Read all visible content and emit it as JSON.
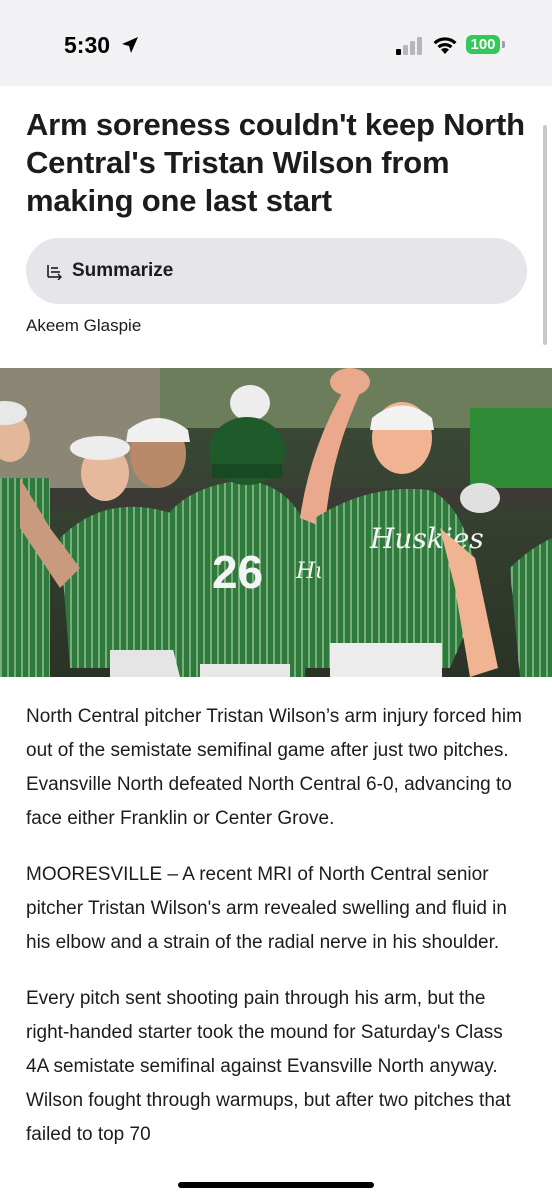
{
  "status_bar": {
    "time": "5:30",
    "battery": "100",
    "icons": [
      "location-arrow-icon",
      "cellular-signal-icon",
      "wifi-icon",
      "battery-icon"
    ]
  },
  "article": {
    "headline": "Arm soreness couldn't keep North Central's Tristan Wilson from making one last start",
    "summarize_label": "Summarize",
    "author": "Akeem Glaspie",
    "photo_text": {
      "helmet_number": "26",
      "jersey_script": "Huskies",
      "jersey_partial": "Husk"
    },
    "paragraphs": [
      {
        "line1": "North Central pitcher Tristan Wilson’s arm injury forced him out of the semistate semifinal game after just two pitches.",
        "line2": "Evansville North defeated North Central 6-0, advancing to face either Franklin or Center Grove."
      },
      {
        "text": "MOORESVILLE – A recent MRI of North Central senior pitcher Tristan Wilson's arm revealed swelling and fluid in his elbow and a strain of the radial nerve in his shoulder."
      },
      {
        "text": "Every pitch sent shooting pain through his arm, but the right-handed starter took the mound for Saturday's Class 4A semistate semifinal against Evansville North anyway. Wilson fought through warmups, but after two pitches that failed to top 70"
      }
    ]
  },
  "colors": {
    "jersey_green": "#2e7a3a",
    "button_bg": "#e5e5ea",
    "battery_green": "#34c759"
  }
}
